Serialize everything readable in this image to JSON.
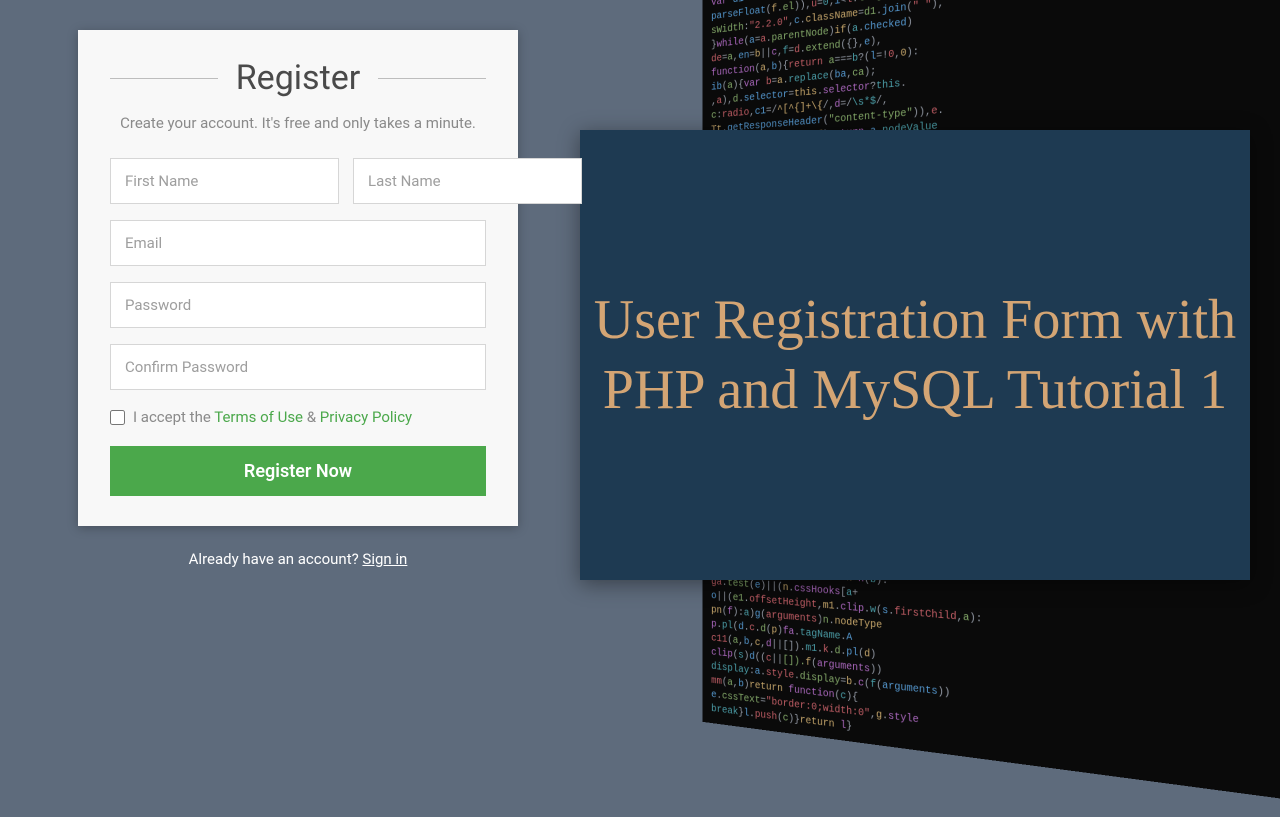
{
  "title_card": {
    "text": "User Registration Form with PHP and MySQL Tutorial 1"
  },
  "form": {
    "heading": "Register",
    "subtitle": "Create your account. It's free and only takes a minute.",
    "first_name_placeholder": "First Name",
    "last_name_placeholder": "Last Name",
    "email_placeholder": "Email",
    "password_placeholder": "Password",
    "confirm_placeholder": "Confirm Password",
    "terms_prefix": "I accept the ",
    "terms_link": "Terms of Use",
    "terms_amp": " & ",
    "privacy_link": "Privacy Policy",
    "submit_label": "Register Now",
    "signin_prefix": "Already have an account? ",
    "signin_link": "Sign in"
  },
  "colors": {
    "accent_green": "#4ba84b",
    "title_bg": "#1e3a52",
    "title_fg": "#d4a574"
  }
}
